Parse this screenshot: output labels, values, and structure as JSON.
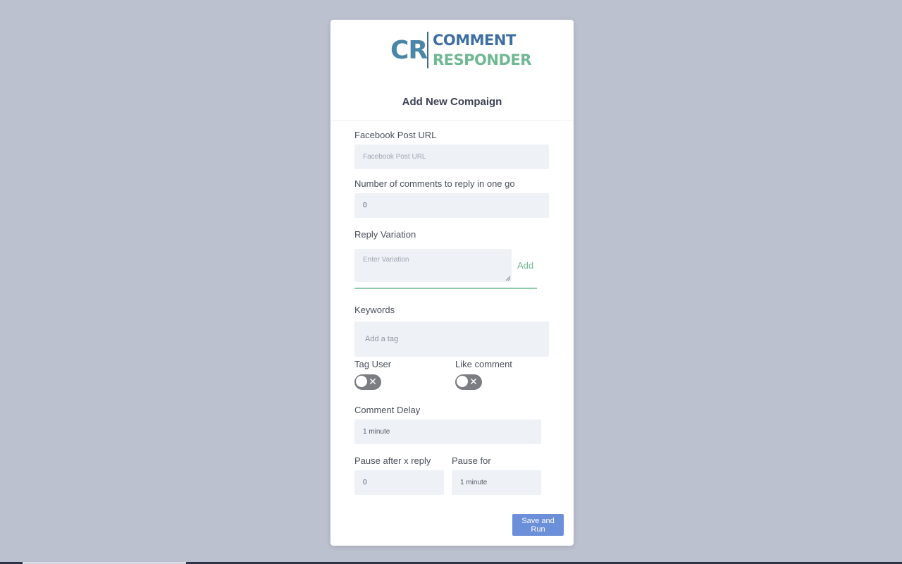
{
  "logo": {
    "mark": "CR",
    "line1": "COMMENT",
    "line2": "RESPONDER"
  },
  "form": {
    "title": "Add New Compaign",
    "post_url": {
      "label": "Facebook Post URL",
      "placeholder": "Facebook Post URL"
    },
    "num_comments": {
      "label": "Number of comments to reply in one go",
      "value": "0"
    },
    "reply_variation": {
      "label": "Reply Variation",
      "placeholder": "Enter Variation",
      "add_label": "Add"
    },
    "keywords": {
      "label": "Keywords",
      "placeholder": "Add a tag"
    },
    "tag_user": {
      "label": "Tag User",
      "enabled": false
    },
    "like_comment": {
      "label": "Like comment",
      "enabled": false
    },
    "comment_delay": {
      "label": "Comment Delay",
      "value": "1 minute"
    },
    "pause_after": {
      "label": "Pause after x reply",
      "value": "0"
    },
    "pause_for": {
      "label": "Pause for",
      "value": "1 minute"
    },
    "submit_label": "Save and Run"
  },
  "colors": {
    "background": "#bcc1cf",
    "accent_green": "#6fb892",
    "brand_blue": "#3f6fa2",
    "button": "#6b8fd9"
  },
  "icons": {
    "toggle_off": "x-icon",
    "resize": "resize-handle-icon"
  }
}
